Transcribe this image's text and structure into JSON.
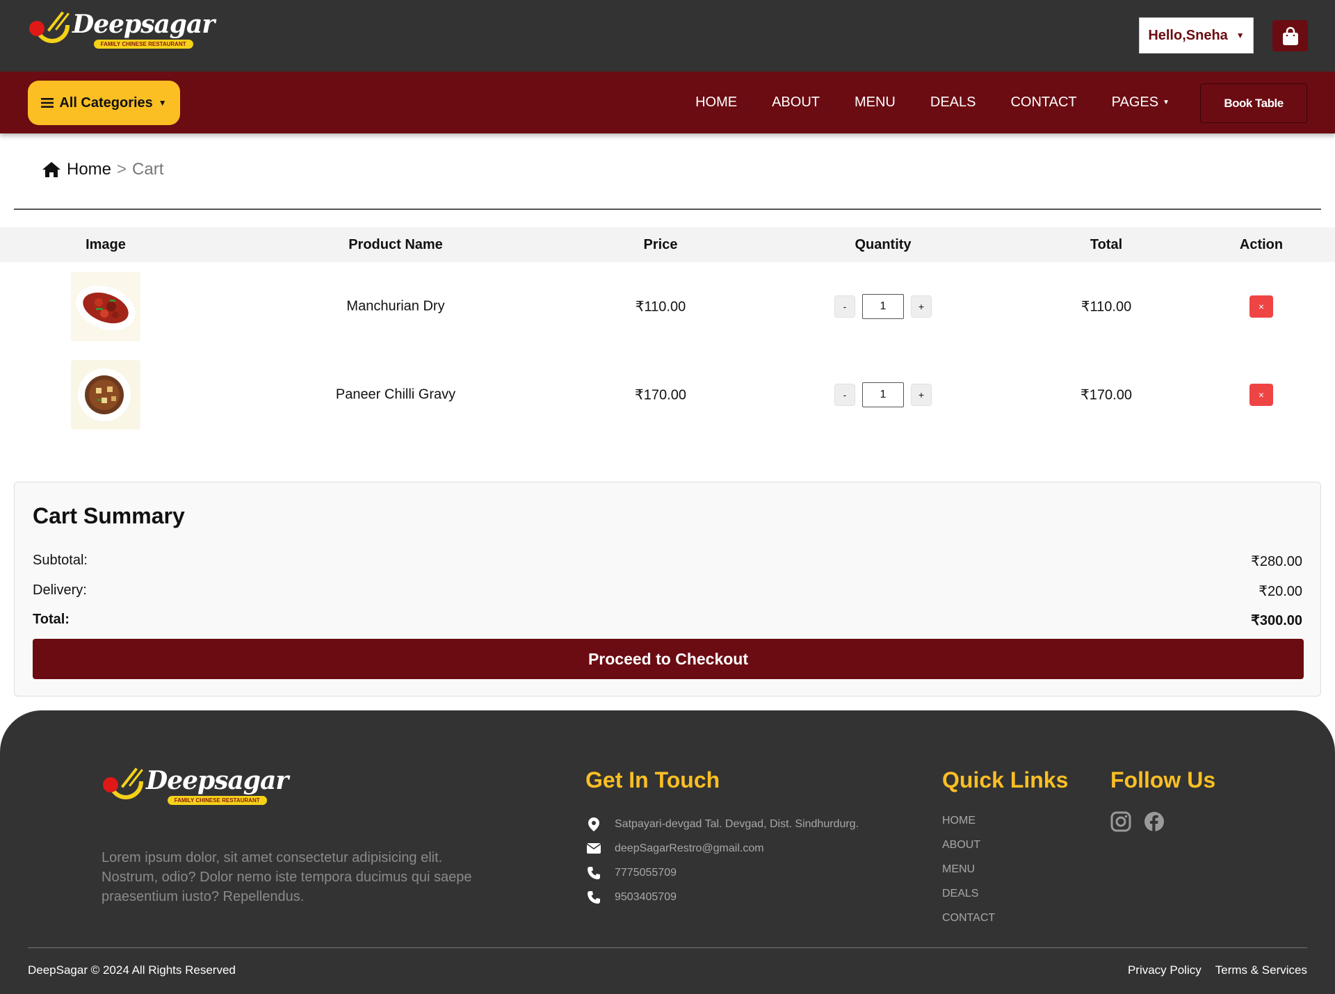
{
  "brand": {
    "name": "Deepsagar",
    "tagline": "FAMILY CHINESE RESTAURANT"
  },
  "header": {
    "greeting": "Hello,Sneha",
    "cart_icon": "shopping-bag-icon"
  },
  "nav": {
    "categories_label": "All Categories",
    "links": [
      "HOME",
      "ABOUT",
      "MENU",
      "DEALS",
      "CONTACT",
      "PAGES"
    ],
    "book_table": "Book Table"
  },
  "breadcrumb": {
    "home": "Home",
    "separator": ">",
    "current": "Cart"
  },
  "cart": {
    "columns": [
      "Image",
      "Product Name",
      "Price",
      "Quantity",
      "Total",
      "Action"
    ],
    "items": [
      {
        "name": "Manchurian Dry",
        "price": "₹110.00",
        "qty": "1",
        "total": "₹110.00",
        "dec": "-",
        "inc": "+",
        "remove": "×"
      },
      {
        "name": "Paneer Chilli Gravy",
        "price": "₹170.00",
        "qty": "1",
        "total": "₹170.00",
        "dec": "-",
        "inc": "+",
        "remove": "×"
      }
    ]
  },
  "summary": {
    "title": "Cart Summary",
    "subtotal_label": "Subtotal:",
    "subtotal": "₹280.00",
    "delivery_label": "Delivery:",
    "delivery": "₹20.00",
    "total_label": "Total:",
    "total": "₹300.00",
    "checkout": "Proceed to Checkout"
  },
  "footer": {
    "description": "Lorem ipsum dolor, sit amet consectetur adipisicing elit. Nostrum, odio? Dolor nemo iste tempora ducimus qui saepe praesentium iusto? Repellendus.",
    "get_in_touch": "Get In Touch",
    "address": "Satpayari-devgad Tal. Devgad, Dist. Sindhurdurg.",
    "email": "deepSagarRestro@gmail.com",
    "phone1": "7775055709",
    "phone2": "9503405709",
    "quick_links_title": "Quick Links",
    "quick_links": [
      "HOME",
      "ABOUT",
      "MENU",
      "DEALS",
      "CONTACT"
    ],
    "follow_title": "Follow Us",
    "copyright": "DeepSagar © 2024 All Rights Reserved",
    "privacy": "Privacy Policy",
    "terms": "Terms & Services"
  },
  "colors": {
    "dark": "#333333",
    "maroon": "#6b0c12",
    "accent": "#fbbf24",
    "danger": "#ef4444"
  }
}
